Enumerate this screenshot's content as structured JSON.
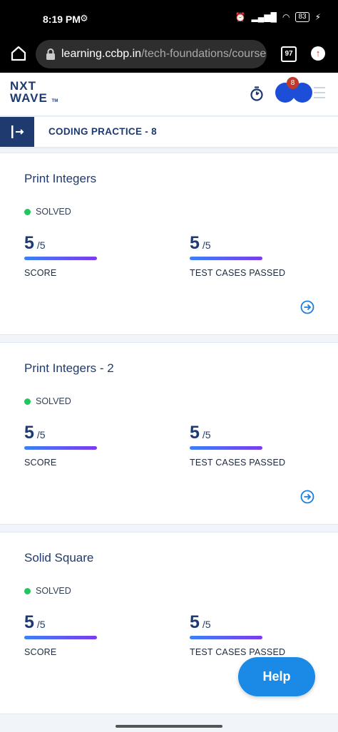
{
  "status_bar": {
    "time": "8:19 PM",
    "battery": "83"
  },
  "browser": {
    "url_domain": "learning.ccbp.in",
    "url_path": "/tech-foundations/course",
    "tab_count": "97"
  },
  "header": {
    "logo_line1": "NXT",
    "logo_line2": "WAVE",
    "logo_tm": "TM",
    "notification_count": "8"
  },
  "section": {
    "title": "CODING PRACTICE - 8"
  },
  "cards": [
    {
      "title": "Print Integers",
      "status": "SOLVED",
      "score_value": "5",
      "score_total": "/5",
      "score_label": "SCORE",
      "tests_value": "5",
      "tests_total": "/5",
      "tests_label": "TEST CASES PASSED"
    },
    {
      "title": "Print Integers - 2",
      "status": "SOLVED",
      "score_value": "5",
      "score_total": "/5",
      "score_label": "SCORE",
      "tests_value": "5",
      "tests_total": "/5",
      "tests_label": "TEST CASES PASSED"
    },
    {
      "title": "Solid Square",
      "status": "SOLVED",
      "score_value": "5",
      "score_total": "/5",
      "score_label": "SCORE",
      "tests_value": "5",
      "tests_total": "/5",
      "tests_label": "TEST CASES PASSED"
    }
  ],
  "help": {
    "label": "Help"
  },
  "colors": {
    "primary": "#1e3a6e",
    "solved": "#22c55e",
    "help": "#1a8ae6",
    "bar_start": "#3b82f6",
    "bar_end": "#7c3aed"
  }
}
